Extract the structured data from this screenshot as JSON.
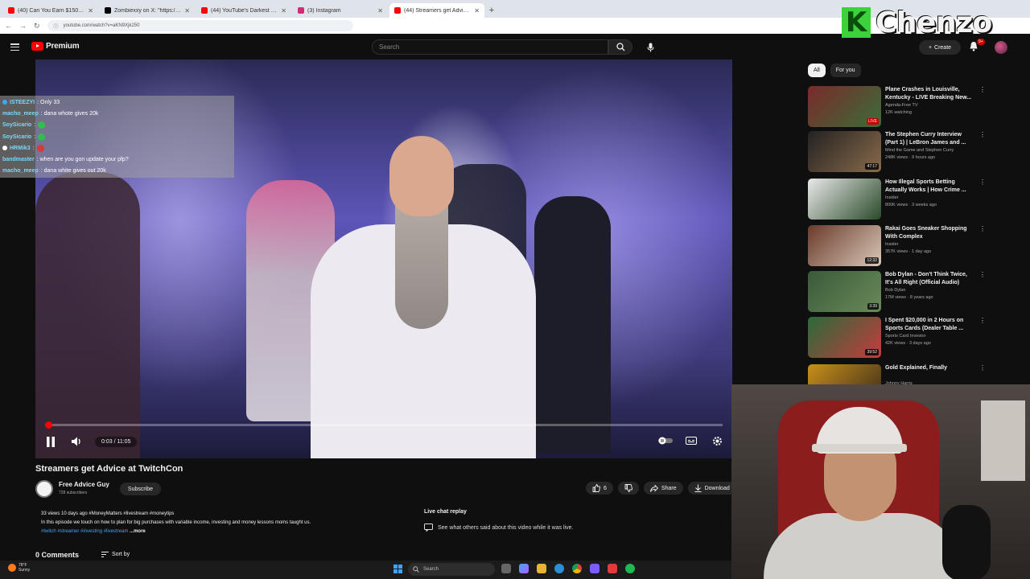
{
  "browser": {
    "tabs": [
      {
        "title": "(40) Can You Earn $150/Hour...",
        "color": "#ff0000",
        "active": false
      },
      {
        "title": "Zombiexxy on X: \"https://t.co/...\"",
        "color": "#000000",
        "active": false
      },
      {
        "title": "(44) YouTube's Darkest Videos...",
        "color": "#ff0000",
        "active": false
      },
      {
        "title": "(3) Instagram",
        "color": "#d62976",
        "active": false
      },
      {
        "title": "(44) Streamers get Advice ...",
        "color": "#ff0000",
        "active": true
      }
    ],
    "new_tab": "+",
    "url": "youtube.com/watch?v=aKN9Xjk250"
  },
  "header": {
    "logo_text": "Premium",
    "search_placeholder": "Search",
    "create_label": "Create",
    "notif_badge": "9+"
  },
  "overlay": {
    "brand_letter": "K",
    "brand_word": "Chenzo"
  },
  "chat": [
    {
      "user": "ISTEEZYI",
      "msg": ": Only 33",
      "dot": "#3ea6ff",
      "emote": ""
    },
    {
      "user": "macho_meep",
      "msg": ": dana whote gives 20k",
      "dot": "",
      "emote": ""
    },
    {
      "user": "SoySicario",
      "msg": ":",
      "dot": "",
      "emote": "#2fbf4a"
    },
    {
      "user": "SoySicario",
      "msg": ":",
      "dot": "",
      "emote": "#2fbf4a"
    },
    {
      "user": "HRMik3",
      "msg": ":",
      "dot": "#ffffff",
      "emote": "#d43c3c"
    },
    {
      "user": "bandmaster",
      "msg": ": when are you gon update your pfp?",
      "dot": "",
      "emote": ""
    },
    {
      "user": "macho_meep",
      "msg": ": dana white gives out 20k",
      "dot": "",
      "emote": ""
    }
  ],
  "player": {
    "time": "0:03 / 11:05",
    "progress_fraction": 0.005
  },
  "video": {
    "title": "Streamers get Advice at TwitchCon",
    "channel": "Free Advice Guy",
    "subscribers": "728 subscribers",
    "subscribe_label": "Subscribe",
    "likes": "6",
    "share_label": "Share",
    "download_label": "Download",
    "meta": "33 views  10 days ago  #MoneyMatters #livestream #moneytips",
    "description": "In this episode we touch on how to plan for big purchases with variable income, investing and money lessons moms taught us.",
    "tags": "#twitch #streamer #investing #livestream",
    "more": "...more",
    "live_chat_title": "Live chat replay",
    "live_chat_sub": "See what others said about this video while it was live.",
    "comments": "0 Comments",
    "sort": "Sort by"
  },
  "sidebar": {
    "chips": [
      "All",
      "For you"
    ],
    "recommendations": [
      {
        "title": "Plane Crashes in Louisville, Kentucky - LIVE Breaking New...",
        "channel": "Agenda-Free TV",
        "stats": "12K watching",
        "duration": "LIVE",
        "thumb": [
          "#7a2a2a",
          "#3a6d3a"
        ]
      },
      {
        "title": "The Stephen Curry Interview (Part 1) | LeBron James and ...",
        "channel": "Mind the Game  and Stephen Curry",
        "stats": "248K views · 9 hours ago",
        "duration": "47:17",
        "thumb": [
          "#222222",
          "#8a6a4a"
        ]
      },
      {
        "title": "How Illegal Sports Betting Actually Works | How Crime ...",
        "channel": "Insider",
        "stats": "800K views · 3 weeks ago",
        "duration": "",
        "thumb": [
          "#e9e9e9",
          "#2a4a2a"
        ]
      },
      {
        "title": "Rakai Goes Sneaker Shopping With Complex",
        "channel": "Insider",
        "stats": "357K views · 1 day ago",
        "duration": "12:32",
        "thumb": [
          "#6a3a2a",
          "#d8c8b8"
        ]
      },
      {
        "title": "Bob Dylan - Don't Think Twice, It's All Right (Official Audio)",
        "channel": "Bob Dylan",
        "stats": "17M views · 8 years ago",
        "duration": "3:39",
        "thumb": [
          "#3a5a3a",
          "#6a8a5a"
        ]
      },
      {
        "title": "I Spent $20,000 in 2 Hours on Sports Cards (Dealer Table ...",
        "channel": "Sports Card Investor",
        "stats": "42K views · 3 days ago",
        "duration": "39:52",
        "thumb": [
          "#2a6a3a",
          "#c43c3c"
        ]
      },
      {
        "title": "Gold Explained, Finally",
        "channel": "Johnny Harris",
        "stats": "",
        "duration": "",
        "thumb": [
          "#c8901a",
          "#3a2a1a"
        ]
      }
    ]
  },
  "taskbar": {
    "temp": "78°F",
    "weather": "Sunny",
    "search": "Search"
  }
}
